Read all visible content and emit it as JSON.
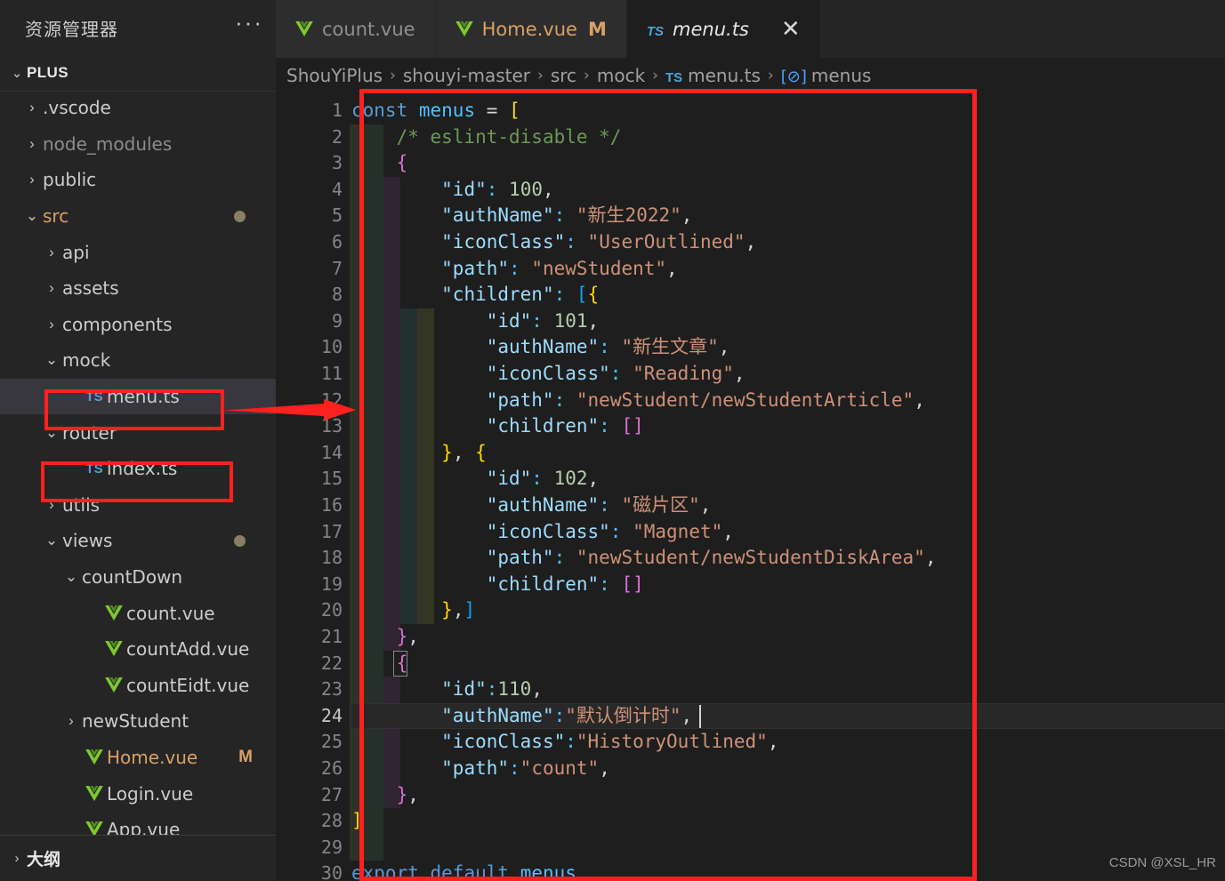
{
  "sidebar": {
    "title": "资源管理器",
    "more_label": "···",
    "section": {
      "label": "PLUS",
      "chevron": "⌄"
    },
    "footer": {
      "label": "大纲",
      "chevron": "›"
    },
    "items": [
      {
        "name": "",
        "indent": 1,
        "twisty": "",
        "kind": "partial",
        "cut": true
      },
      {
        "name": ".vscode",
        "indent": 1,
        "twisty": "›",
        "kind": "folder"
      },
      {
        "name": "node_modules",
        "indent": 1,
        "twisty": "›",
        "kind": "folder-dim"
      },
      {
        "name": "public",
        "indent": 1,
        "twisty": "›",
        "kind": "folder"
      },
      {
        "name": "src",
        "indent": 1,
        "twisty": "⌄",
        "kind": "folder-open",
        "dot": true
      },
      {
        "name": "api",
        "indent": 2,
        "twisty": "›",
        "kind": "folder"
      },
      {
        "name": "assets",
        "indent": 2,
        "twisty": "›",
        "kind": "folder"
      },
      {
        "name": "components",
        "indent": 2,
        "twisty": "›",
        "kind": "folder"
      },
      {
        "name": "mock",
        "indent": 2,
        "twisty": "⌄",
        "kind": "folder"
      },
      {
        "name": "menu.ts",
        "indent": 3,
        "twisty": "",
        "kind": "ts",
        "selected": true
      },
      {
        "name": "router",
        "indent": 2,
        "twisty": "⌄",
        "kind": "folder"
      },
      {
        "name": "index.ts",
        "indent": 3,
        "twisty": "",
        "kind": "ts"
      },
      {
        "name": "utils",
        "indent": 2,
        "twisty": "›",
        "kind": "folder"
      },
      {
        "name": "views",
        "indent": 2,
        "twisty": "⌄",
        "kind": "folder",
        "dot": true
      },
      {
        "name": "countDown",
        "indent": 3,
        "twisty": "⌄",
        "kind": "folder"
      },
      {
        "name": "count.vue",
        "indent": 4,
        "twisty": "",
        "kind": "vue"
      },
      {
        "name": "countAdd.vue",
        "indent": 4,
        "twisty": "",
        "kind": "vue"
      },
      {
        "name": "countEidt.vue",
        "indent": 4,
        "twisty": "",
        "kind": "vue"
      },
      {
        "name": "newStudent",
        "indent": 3,
        "twisty": "›",
        "kind": "folder"
      },
      {
        "name": "Home.vue",
        "indent": 3,
        "twisty": "",
        "kind": "vue-mod",
        "badge": "M"
      },
      {
        "name": "Login.vue",
        "indent": 3,
        "twisty": "",
        "kind": "vue"
      },
      {
        "name": "App.vue",
        "indent": 3,
        "twisty": "",
        "kind": "vue",
        "cut": true
      }
    ]
  },
  "tabs": [
    {
      "label": "count.vue",
      "icon": "vue-icon",
      "active": false,
      "modified": false,
      "badge": ""
    },
    {
      "label": "Home.vue",
      "icon": "vue-icon",
      "active": false,
      "modified": true,
      "badge": "M"
    },
    {
      "label": "menu.ts",
      "icon": "ts-icon",
      "active": true,
      "modified": false,
      "badge": "",
      "close": "✕"
    }
  ],
  "breadcrumb": {
    "separator": "›",
    "items": [
      {
        "label": "ShouYiPlus",
        "icon": ""
      },
      {
        "label": "shouyi-master",
        "icon": ""
      },
      {
        "label": "src",
        "icon": ""
      },
      {
        "label": "mock",
        "icon": ""
      },
      {
        "label": "menu.ts",
        "icon": "ts-icon"
      },
      {
        "label": "menus",
        "icon": "symbol-array-icon"
      }
    ]
  },
  "editor": {
    "filename": "menu.ts",
    "language": "typescript",
    "current_line": 24,
    "total_lines_shown": 30,
    "lines": [
      {
        "n": 1,
        "text": "const menus = ["
      },
      {
        "n": 2,
        "text": "    /* eslint-disable */"
      },
      {
        "n": 3,
        "text": "    {"
      },
      {
        "n": 4,
        "text": "        \"id\": 100,"
      },
      {
        "n": 5,
        "text": "        \"authName\": \"新生2022\","
      },
      {
        "n": 6,
        "text": "        \"iconClass\": \"UserOutlined\","
      },
      {
        "n": 7,
        "text": "        \"path\": \"newStudent\","
      },
      {
        "n": 8,
        "text": "        \"children\": [{"
      },
      {
        "n": 9,
        "text": "            \"id\": 101,"
      },
      {
        "n": 10,
        "text": "            \"authName\": \"新生文章\","
      },
      {
        "n": 11,
        "text": "            \"iconClass\": \"Reading\","
      },
      {
        "n": 12,
        "text": "            \"path\": \"newStudent/newStudentArticle\","
      },
      {
        "n": 13,
        "text": "            \"children\": []"
      },
      {
        "n": 14,
        "text": "        }, {"
      },
      {
        "n": 15,
        "text": "            \"id\": 102,"
      },
      {
        "n": 16,
        "text": "            \"authName\": \"磁片区\","
      },
      {
        "n": 17,
        "text": "            \"iconClass\": \"Magnet\","
      },
      {
        "n": 18,
        "text": "            \"path\": \"newStudent/newStudentDiskArea\","
      },
      {
        "n": 19,
        "text": "            \"children\": []"
      },
      {
        "n": 20,
        "text": "        },]"
      },
      {
        "n": 21,
        "text": "    },"
      },
      {
        "n": 22,
        "text": "    {"
      },
      {
        "n": 23,
        "text": "        \"id\":110,"
      },
      {
        "n": 24,
        "text": "        \"authName\":\"默认倒计时\","
      },
      {
        "n": 25,
        "text": "        \"iconClass\":\"HistoryOutlined\","
      },
      {
        "n": 26,
        "text": "        \"path\":\"count\","
      },
      {
        "n": 27,
        "text": "    },"
      },
      {
        "n": 28,
        "text": "]"
      },
      {
        "n": 29,
        "text": ""
      },
      {
        "n": 30,
        "text": "export default menus"
      }
    ]
  },
  "annotations": {
    "code_box": "red-rect-around-code",
    "menu_ts_box": "red-rect-menu-ts",
    "index_ts_box": "red-rect-index-ts",
    "arrow": "red-arrow-menu-ts-to-code"
  },
  "watermark": "CSDN @XSL_HR",
  "colors": {
    "accent_red": "#ff2020",
    "editor_bg": "#1e1e1e",
    "sidebar_bg": "#252526",
    "selection_bg": "#37373d",
    "string": "#ce9178",
    "number": "#b5cea8",
    "keyword": "#c586c0",
    "keyword_blue": "#569cd6",
    "comment": "#6a9955",
    "property": "#9cdcfe",
    "bracket1": "#ffd700",
    "bracket2": "#da70d6",
    "bracket3": "#179fff",
    "modified": "#d9a066",
    "ts_blue": "#4ea3d8",
    "vue_green": "#7ec82e"
  }
}
